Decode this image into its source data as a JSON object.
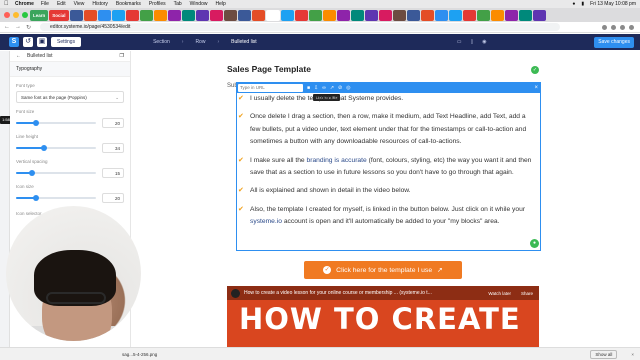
{
  "os": {
    "app": "Chrome",
    "menus": [
      "File",
      "Edit",
      "View",
      "History",
      "Bookmarks",
      "Profiles",
      "Tab",
      "Window",
      "Help"
    ],
    "clock": "Fri 13 May 10:08 pm"
  },
  "tabs": {
    "badges": [
      "Learn",
      "Social"
    ],
    "count": 34
  },
  "browser": {
    "url": "editor.systeme.io/page/4530534/edit"
  },
  "editor": {
    "settings_label": "Settings",
    "breadcrumbs": [
      "Section",
      "Row",
      "Bulleted list"
    ],
    "save_label": "Save changes"
  },
  "panel": {
    "title": "Bulleted list",
    "section": "Typography",
    "font_type_label": "Font type",
    "font_type_value": "Same font as the page (Poppins)",
    "fields": [
      {
        "label": "Font size",
        "value": "20",
        "level": 0.25
      },
      {
        "label": "Line height",
        "value": "34",
        "level": 0.35
      },
      {
        "label": "Vertical spacing",
        "value": "15",
        "level": 0.2
      },
      {
        "label": "Icon size",
        "value": "20",
        "level": 0.25
      }
    ],
    "icon_selector_label": "Icon selector"
  },
  "canvas": {
    "title": "Sales Page Template",
    "subline": "Sub",
    "toolbar": {
      "url_placeholder": "Type in URL",
      "tooltip": "Link to a file"
    },
    "bullets": [
      {
        "parts": [
          {
            "t": "I usually delete the template that Systeme provides.",
            "hl": false
          }
        ]
      },
      {
        "parts": [
          {
            "t": "Once delete I drag a section, then a row, make it medium, add Text Headline, add Text, add a few bullets, put a video under, text element under that for the timestamps or call-to-action and sometimes a button with any downloadable resources of call-to-actions.",
            "hl": false
          }
        ]
      },
      {
        "parts": [
          {
            "t": "I make sure all the ",
            "hl": false
          },
          {
            "t": "branding is accurate",
            "hl": true
          },
          {
            "t": " (font, colours, styling, etc) the way you want it and then save that as a section to use in future lessons so you don't have to go through that again.",
            "hl": false
          }
        ]
      },
      {
        "parts": [
          {
            "t": "All is explained and shown in detail in the video below.",
            "hl": false
          }
        ]
      },
      {
        "parts": [
          {
            "t": "Also, the template I created for myself, is linked in the button below. Just click on it while your ",
            "hl": false
          },
          {
            "t": "systeme.io",
            "hl": true
          },
          {
            "t": " account is open and it'll automatically be added to your \"my blocks\" area.",
            "hl": false
          }
        ]
      }
    ],
    "cta_label": "Click here for the template I use",
    "video": {
      "title": "How to create a video lesson for your online course or membership ... (systeme.io t...",
      "watch_later": "Watch later",
      "share": "Share",
      "big_text": "HOW TO CREATE"
    }
  },
  "downloads": {
    "file": "sag...5-4-256.png",
    "show_all": "Show all"
  },
  "colors": {
    "accent": "#2e8ff0",
    "editor_bar": "#1e2a5a",
    "check": "#f0a01a",
    "cta": "#f07a22",
    "video": "#d9461f"
  }
}
